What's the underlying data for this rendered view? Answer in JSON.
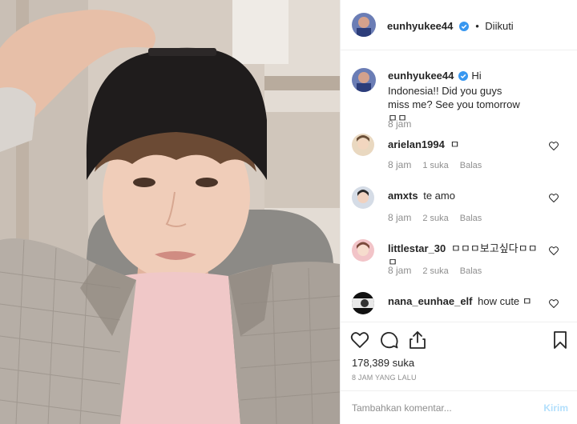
{
  "post": {
    "author": "eunhyukee44",
    "follow_dot": "•",
    "follow_status": "Diikuti",
    "caption": "Hi Indonesia!! Did you guys miss me? See you tomorrow ㅁㅁ",
    "caption_time": "8 jam"
  },
  "comments": [
    {
      "user": "arielan1994",
      "text": "ㅁ",
      "time": "8 jam",
      "likes": "1 suka",
      "reply": "Balas"
    },
    {
      "user": "amxts",
      "text": "te amo",
      "time": "8 jam",
      "likes": "2 suka",
      "reply": "Balas"
    },
    {
      "user": "littlestar_30",
      "text": "ㅁㅁㅁ보고싶다ㅁㅁㅁ",
      "time": "8 jam",
      "likes": "2 suka",
      "reply": "Balas"
    },
    {
      "user": "nana_eunhae_elf",
      "text": "how cute ㅁ",
      "time": "",
      "likes": "",
      "reply": ""
    }
  ],
  "footer": {
    "likes": "178,389 suka",
    "time_ago": "8 JAM YANG LALU",
    "comment_placeholder": "Tambahkan komentar...",
    "send_label": "Kirim"
  },
  "colors": {
    "verified_badge": "#3897f0",
    "muted_text": "#8e8e8e",
    "send_disabled": "#b2dffc"
  },
  "icons": [
    "verified-icon",
    "heart-icon",
    "comment-icon",
    "share-icon",
    "bookmark-icon"
  ]
}
